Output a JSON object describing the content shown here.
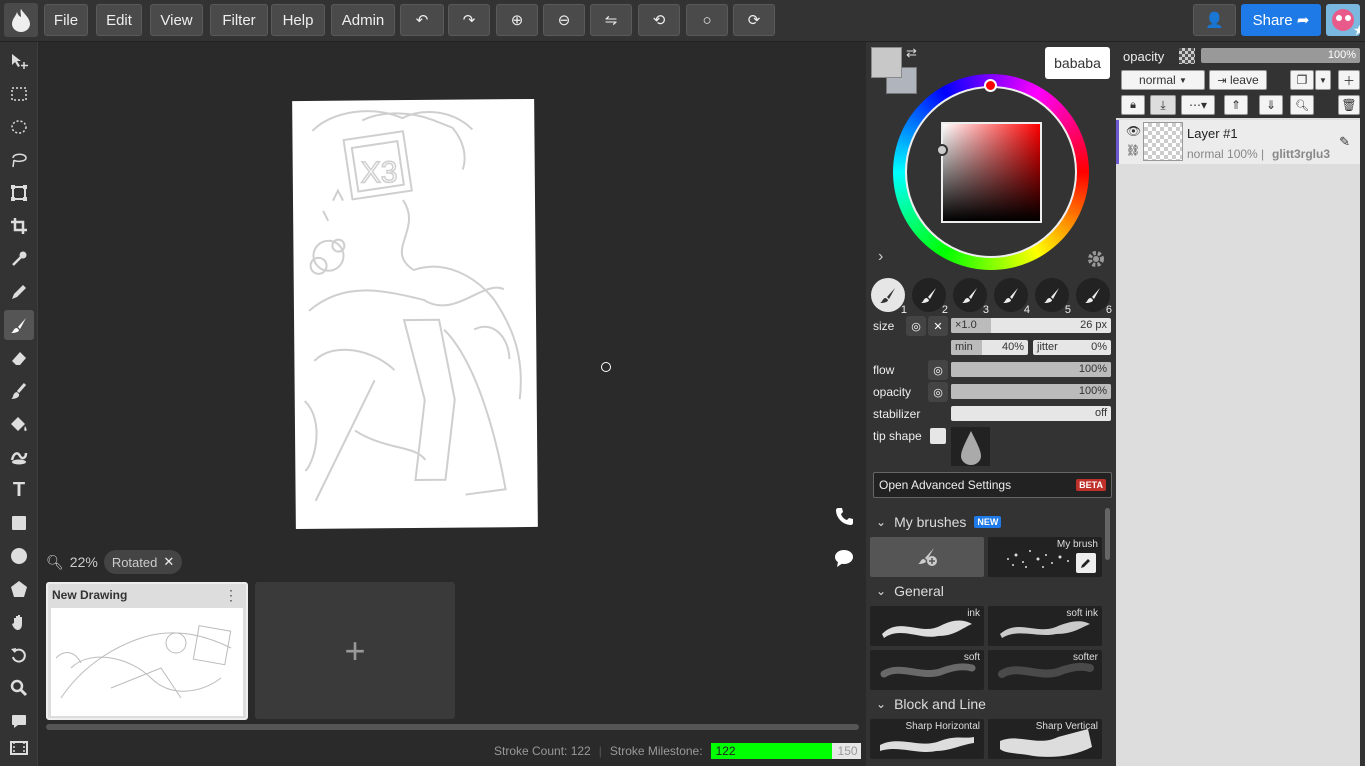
{
  "topbar": {
    "menus": [
      "File",
      "Edit",
      "View",
      "Filter",
      "Help",
      "Admin"
    ],
    "share_label": "Share"
  },
  "canvas": {
    "zoom": "22%",
    "rotated_label": "Rotated",
    "drawing_title": "New Drawing",
    "add_label": "+"
  },
  "status": {
    "stroke_count": "Stroke Count: 122",
    "milestone_label": "Stroke Milestone:",
    "milestone_value": "122",
    "milestone_target": "150",
    "milestone_progress": 0.81
  },
  "color": {
    "primary": "#c8c8c8",
    "secondary": "#b0b4bc",
    "ring_selected": "#ff0000"
  },
  "brush": {
    "slots": [
      "1",
      "2",
      "3",
      "4",
      "5",
      "6"
    ],
    "size_label": "size",
    "size_multiplier": "×1.0",
    "size_value": "26 px",
    "min_label": "min",
    "min_value": "40%",
    "jitter_label": "jitter",
    "jitter_value": "0%",
    "flow_label": "flow",
    "flow_value": "100%",
    "opacity_label": "opacity",
    "opacity_value": "100%",
    "stabilizer_label": "stabilizer",
    "stabilizer_value": "off",
    "tip_label": "tip shape",
    "advanced_label": "Open Advanced Settings",
    "beta_badge": "BETA"
  },
  "library": {
    "my_brushes": "My brushes",
    "new_badge": "NEW",
    "my_brush_name": "My brush",
    "general": "General",
    "general_brushes": [
      "ink",
      "soft ink",
      "soft",
      "softer"
    ],
    "block_and_line": "Block and Line",
    "block_brushes": [
      "Sharp Horizontal",
      "Sharp Vertical"
    ]
  },
  "layers": {
    "tooltip_user": "bababa",
    "opacity_label": "opacity",
    "opacity_value": "100%",
    "blend_mode": "normal",
    "leave_label": "leave",
    "layer_name": "Layer #1",
    "layer_meta": "normal 100% |",
    "layer_owner": "glitt3rglu3"
  }
}
